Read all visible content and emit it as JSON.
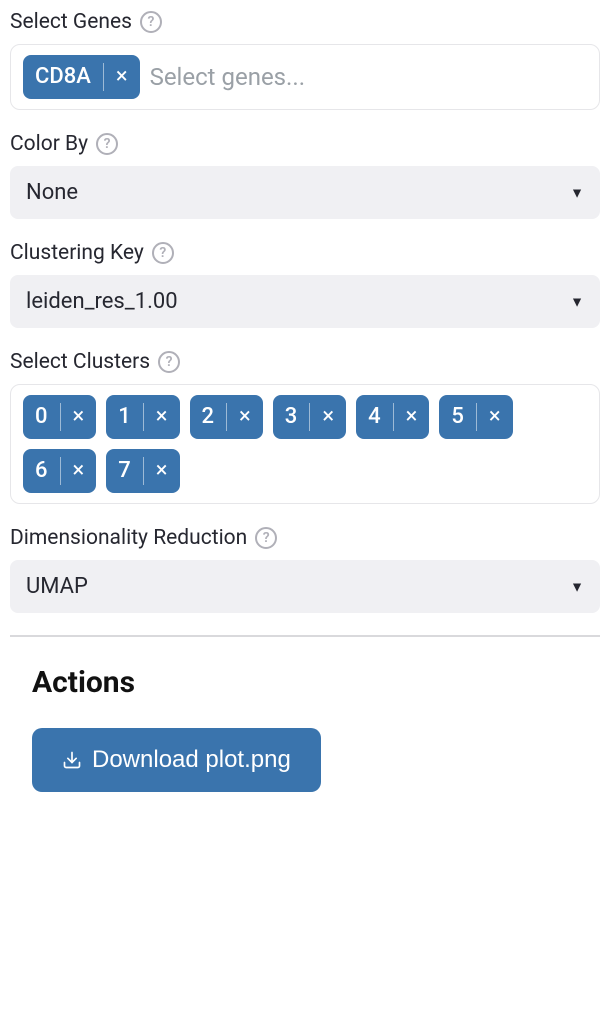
{
  "genes": {
    "label": "Select Genes",
    "placeholder": "Select genes...",
    "selected": [
      "CD8A"
    ]
  },
  "color_by": {
    "label": "Color By",
    "value": "None"
  },
  "clustering_key": {
    "label": "Clustering Key",
    "value": "leiden_res_1.00"
  },
  "clusters": {
    "label": "Select Clusters",
    "selected": [
      "0",
      "1",
      "2",
      "3",
      "4",
      "5",
      "6",
      "7"
    ]
  },
  "dimred": {
    "label": "Dimensionality Reduction",
    "value": "UMAP"
  },
  "actions": {
    "heading": "Actions",
    "download_label": "Download plot.png"
  },
  "help_glyph": "?"
}
